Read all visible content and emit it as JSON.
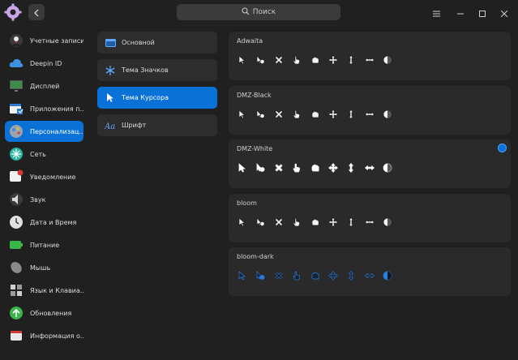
{
  "search": {
    "placeholder": "Поиск"
  },
  "sidebar": {
    "items": [
      {
        "label": "Учетные записи",
        "icon": "accounts-icon",
        "color": "#c0392b"
      },
      {
        "label": "Deepin ID",
        "icon": "cloud-icon",
        "color": "#3d8fe0"
      },
      {
        "label": "Дисплей",
        "icon": "display-icon",
        "color": "#3e8c4a"
      },
      {
        "label": "Приложения п...",
        "icon": "default-apps-icon",
        "color": "#2d7bd6"
      },
      {
        "label": "Персонализац...",
        "icon": "personalization-icon",
        "color": "#9aa4ad"
      },
      {
        "label": "Сеть",
        "icon": "network-icon",
        "color": "#26b5a0"
      },
      {
        "label": "Уведомление",
        "icon": "notification-icon",
        "color": "#d23a3a"
      },
      {
        "label": "Звук",
        "icon": "sound-icon",
        "color": "#8a8a8a"
      },
      {
        "label": "Дата и Время",
        "icon": "datetime-icon",
        "color": "#e0e0e0"
      },
      {
        "label": "Питание",
        "icon": "power-icon",
        "color": "#3bb54a"
      },
      {
        "label": "Мышь",
        "icon": "mouse-icon",
        "color": "#8a8a8a"
      },
      {
        "label": "Язык и  Клавиа...",
        "icon": "keyboard-icon",
        "color": "#7a7a7a"
      },
      {
        "label": "Обновления",
        "icon": "update-icon",
        "color": "#3bb54a"
      },
      {
        "label": "Информация о...",
        "icon": "info-icon",
        "color": "#d23a3a"
      }
    ],
    "active_index": 4
  },
  "personalization": {
    "items": [
      {
        "label": "Основной",
        "icon": "window-icon"
      },
      {
        "label": "Тема Значков",
        "icon": "snowflake-icon"
      },
      {
        "label": "Тема Курсора",
        "icon": "cursor-icon"
      },
      {
        "label": "Шрифт",
        "icon": "font-icon"
      }
    ],
    "active_index": 2
  },
  "cursor_themes": [
    {
      "name": "Adwaita",
      "selected": false,
      "style": "light"
    },
    {
      "name": "DMZ-Black",
      "selected": false,
      "style": "light"
    },
    {
      "name": "DMZ-White",
      "selected": true,
      "style": "white"
    },
    {
      "name": "bloom",
      "selected": false,
      "style": "bloom"
    },
    {
      "name": "bloom-dark",
      "selected": false,
      "style": "dark"
    }
  ],
  "cursor_icons": [
    "arrow-cursor-icon",
    "help-cursor-icon",
    "cross-cursor-icon",
    "pointer-cursor-icon",
    "grab-cursor-icon",
    "move-cursor-icon",
    "resize-v-cursor-icon",
    "resize-h-cursor-icon",
    "busy-cursor-icon"
  ],
  "colors": {
    "accent": "#0a72d6",
    "background": "#202020",
    "card": "#2a2a2a"
  }
}
